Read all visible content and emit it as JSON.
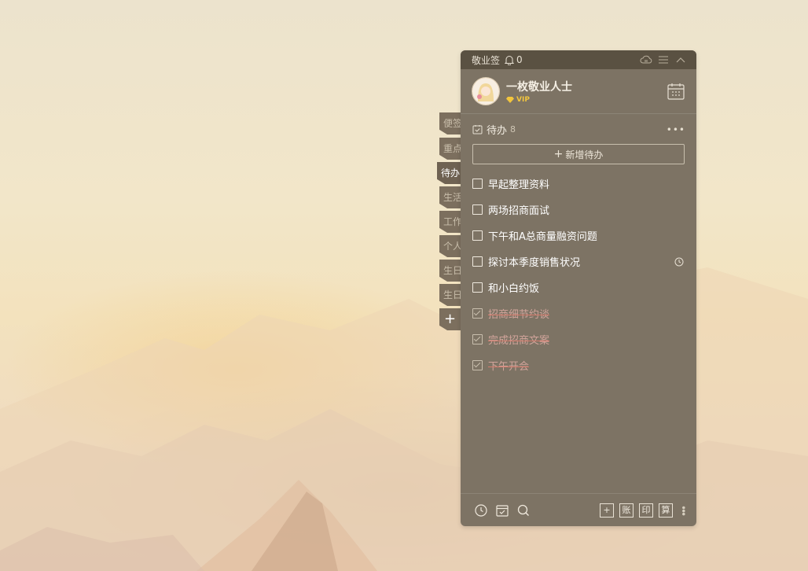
{
  "app": {
    "title": "敬业签",
    "notification_count": "0"
  },
  "user": {
    "name": "一枚敬业人士",
    "badge": "VIP"
  },
  "side_tabs": [
    {
      "label": "便签",
      "active": false
    },
    {
      "label": "重点",
      "active": false
    },
    {
      "label": "待办",
      "active": true
    },
    {
      "label": "生活",
      "active": false
    },
    {
      "label": "工作",
      "active": false
    },
    {
      "label": "个人",
      "active": false
    },
    {
      "label": "生日",
      "active": false
    },
    {
      "label": "生日",
      "active": false
    },
    {
      "label": "+",
      "active": false
    }
  ],
  "section": {
    "title": "待办",
    "count": "8",
    "more_label": "•••"
  },
  "add_todo": {
    "plus": "+",
    "label": "新增待办"
  },
  "todos": [
    {
      "text": "早起整理资料",
      "done": false,
      "has_reminder": false
    },
    {
      "text": "两场招商面试",
      "done": false,
      "has_reminder": false
    },
    {
      "text": "下午和A总商量融资问题",
      "done": false,
      "has_reminder": false
    },
    {
      "text": "探讨本季度销售状况",
      "done": false,
      "has_reminder": true
    },
    {
      "text": "和小白约饭",
      "done": false,
      "has_reminder": false
    },
    {
      "text": "招商细节约谈",
      "done": true,
      "has_reminder": false
    },
    {
      "text": "完成招商文案",
      "done": true,
      "has_reminder": false
    },
    {
      "text": "下午开会",
      "done": true,
      "has_reminder": false
    }
  ],
  "bottom_bar": {
    "left_icons": [
      "clock-icon",
      "calendar-check-icon",
      "search-icon"
    ],
    "right_buttons": [
      "+",
      "账",
      "印",
      "算"
    ],
    "more": "⋮"
  },
  "colors": {
    "panel_bg": "#7d7364",
    "titlebar_bg": "#5a5142",
    "vip": "#f2c53d",
    "done_text": "#d1a49b"
  }
}
